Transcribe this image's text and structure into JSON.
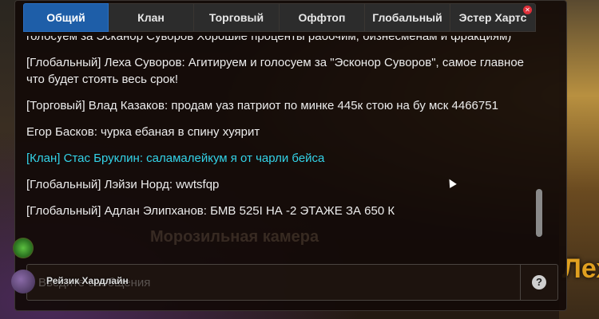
{
  "tabs": [
    {
      "label": "Общий",
      "active": true
    },
    {
      "label": "Клан",
      "active": false
    },
    {
      "label": "Торговый",
      "active": false
    },
    {
      "label": "Оффтоп",
      "active": false
    },
    {
      "label": "Глобальный",
      "active": false
    },
    {
      "label": "Эстер Хартс",
      "active": false,
      "closable": true
    }
  ],
  "messages": [
    {
      "text": "голосуем за Эсканор Суворов Хорошие проценты рабочим, бизнесменам и фракциям)",
      "type": "normal"
    },
    {
      "text": "[Глобальный] Леха Суворов: Агитируем и голосуем за \"Эсконор Суворов\", самое главное что будет стоять весь срок!",
      "type": "normal"
    },
    {
      "text": "[Торговый] Влад Казаков: продам уаз патриот по минке 445к стою на бу мск 4466751",
      "type": "normal"
    },
    {
      "text": "Егор Басков: чурка ебаная в спину хуярит",
      "type": "normal"
    },
    {
      "text": "[Клан] Стас Бруклин: саламалейкум я от чарли бейса",
      "type": "clan"
    },
    {
      "text": "[Глобальный] Лэйзи Норд: wwtsfqp",
      "type": "normal"
    },
    {
      "text": "[Глобальный] Адлан Элипханов: БМВ 525I НА -2 ЭТАЖЕ ЗА 650 К",
      "type": "normal"
    }
  ],
  "input": {
    "placeholder": "Введите сообщения"
  },
  "player": {
    "name": "Рейзик Хардлайн"
  },
  "background": {
    "sign_text": "Лех",
    "faded_text": "Морозильная камера"
  },
  "colors": {
    "active_tab": "#1e5ea8",
    "clan_message": "#33d3e8",
    "close_badge": "#e0303a"
  },
  "icons": {
    "help": "question-icon",
    "close": "close-icon"
  }
}
